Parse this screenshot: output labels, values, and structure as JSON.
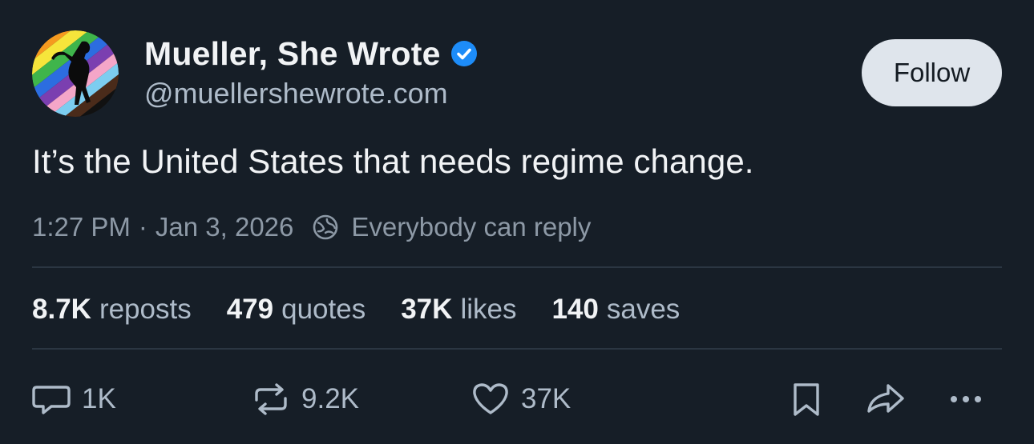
{
  "author": {
    "display_name": "Mueller, She Wrote",
    "handle": "@muellershewrote.com",
    "verified_icon": "verified-badge-icon",
    "avatar_colors": [
      "#e8313a",
      "#f59a1f",
      "#f6e53b",
      "#3fb54b",
      "#2c6de0",
      "#7b3fb0",
      "#f4a6c8",
      "#7ccdf0",
      "#4a2b1a"
    ]
  },
  "follow_button": {
    "label": "Follow"
  },
  "post": {
    "text": "It’s the United States that needs regime change.",
    "time": "1:27 PM",
    "separator": "·",
    "date": "Jan 3, 2026",
    "reply_setting_icon": "globe-icon",
    "reply_setting": "Everybody can reply"
  },
  "stats": [
    {
      "value": "8.7K",
      "label": "reposts"
    },
    {
      "value": "479",
      "label": "quotes"
    },
    {
      "value": "37K",
      "label": "likes"
    },
    {
      "value": "140",
      "label": "saves"
    }
  ],
  "actions": {
    "reply": {
      "icon": "reply-icon",
      "count": "1K"
    },
    "repost": {
      "icon": "repost-icon",
      "count": "9.2K"
    },
    "like": {
      "icon": "heart-icon",
      "count": "37K"
    },
    "bookmark": {
      "icon": "bookmark-icon"
    },
    "share": {
      "icon": "share-icon"
    },
    "more": {
      "icon": "more-icon"
    }
  },
  "colors": {
    "background": "#161e27",
    "verified": "#1d8cf8",
    "follow_button_bg": "#dfe5ec",
    "muted_text": "#8d99a6"
  }
}
